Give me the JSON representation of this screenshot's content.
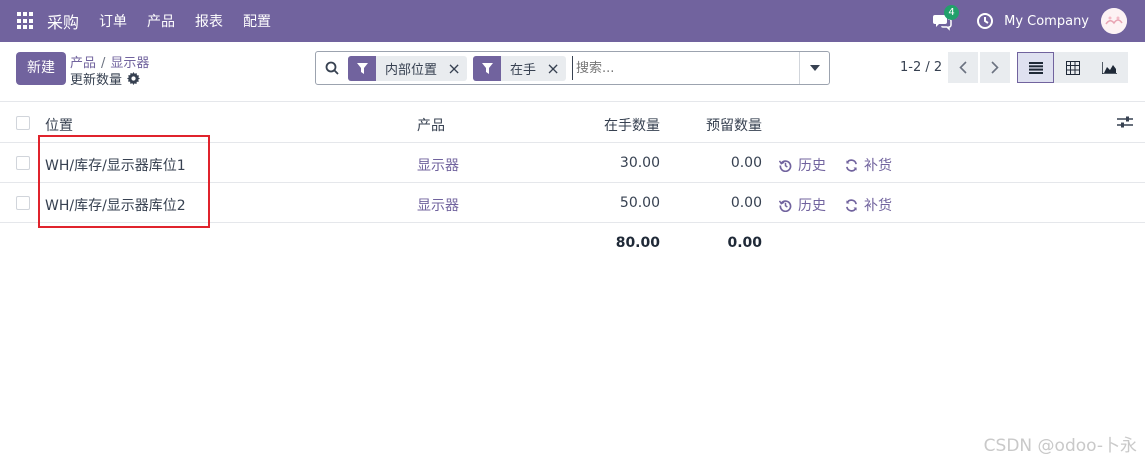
{
  "navbar": {
    "app_name": "采购",
    "menus": [
      "订单",
      "产品",
      "报表",
      "配置"
    ],
    "message_count": "4",
    "company": "My Company"
  },
  "control": {
    "new_button": "新建",
    "breadcrumb": [
      "产品",
      "显示器"
    ],
    "current_title": "更新数量",
    "search": {
      "facets": [
        "内部位置",
        "在手"
      ],
      "placeholder": "搜索..."
    },
    "pager": "1-2 / 2"
  },
  "table": {
    "headers": {
      "location": "位置",
      "product": "产品",
      "on_hand": "在手数量",
      "reserved": "预留数量"
    },
    "rows": [
      {
        "location": "WH/库存/显示器库位1",
        "product": "显示器",
        "on_hand": "30.00",
        "reserved": "0.00",
        "history": "历史",
        "replenish": "补货"
      },
      {
        "location": "WH/库存/显示器库位2",
        "product": "显示器",
        "on_hand": "50.00",
        "reserved": "0.00",
        "history": "历史",
        "replenish": "补货"
      }
    ],
    "totals": {
      "on_hand": "80.00",
      "reserved": "0.00"
    }
  },
  "watermark": "CSDN @odoo-卜永",
  "colors": {
    "brand": "#71639e",
    "highlight": "#e0232c",
    "badge": "#22a06b"
  }
}
